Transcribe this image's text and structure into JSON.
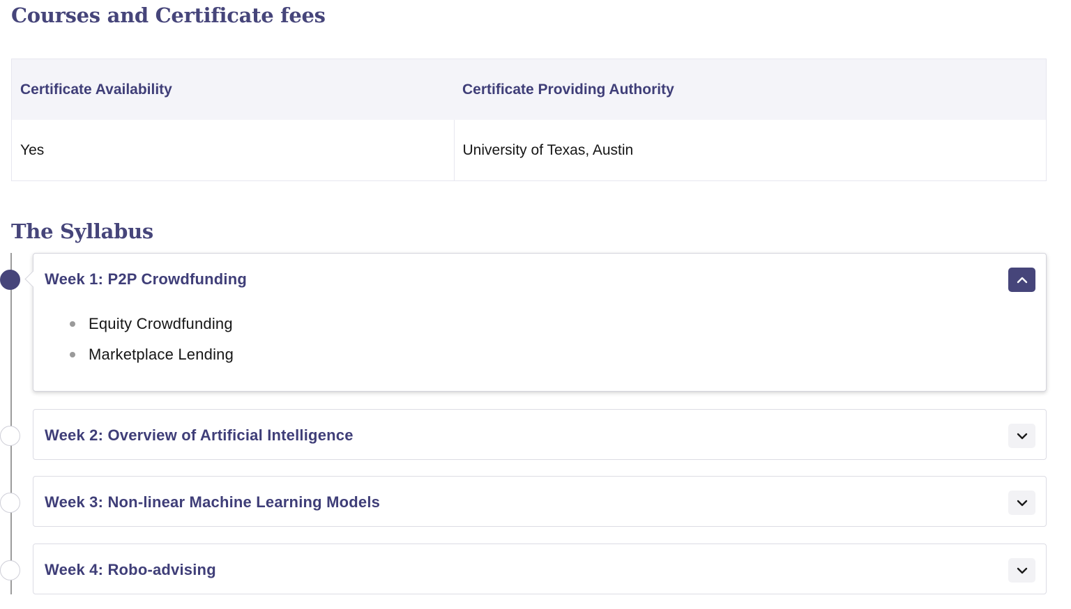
{
  "headings": {
    "fees": "Courses and Certificate fees",
    "syllabus": "The Syllabus"
  },
  "certificate_table": {
    "headers": [
      "Certificate Availability",
      "Certificate Providing Authority"
    ],
    "row": [
      "Yes",
      "University of Texas, Austin"
    ]
  },
  "weeks": [
    {
      "title": "Week 1: P2P Crowdfunding",
      "expanded": true,
      "topics": [
        "Equity Crowdfunding",
        "Marketplace Lending"
      ]
    },
    {
      "title": "Week 2: Overview of Artificial Intelligence",
      "expanded": false
    },
    {
      "title": "Week 3: Non-linear Machine Learning Models",
      "expanded": false
    },
    {
      "title": "Week 4: Robo-advising",
      "expanded": false
    }
  ],
  "icons": {
    "expanded_toggle": "chevron-up-icon",
    "collapsed_toggle": "chevron-down-icon"
  },
  "colors": {
    "brand": "#46457a",
    "header_bg": "#f4f4f9"
  }
}
